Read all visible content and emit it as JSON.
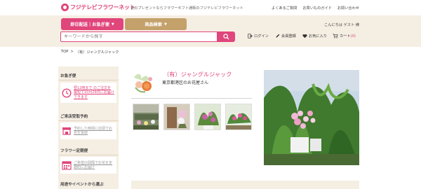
{
  "header": {
    "logo_text": "フジテレビフラワーネット",
    "tagline": "花のプレゼントならフラワーギフト通販のフジテレビフラワーネット",
    "links": [
      "よくあるご質問",
      "お買いものガイド",
      "お問い合わせ"
    ],
    "greeting": "こんにちは ゲスト 様"
  },
  "nav": {
    "tab_fast": "即日配送｜お急ぎ便",
    "tab_search": "商品検索",
    "search_placeholder": "キーワードから探す",
    "login": "ログイン",
    "register": "会員登録",
    "favorites": "お気に入り",
    "cart": "カート",
    "cart_count": "(0)"
  },
  "breadcrumb": {
    "home": "TOP",
    "sep": ">",
    "current": "（有）ジャングルジャック"
  },
  "sidebar": {
    "rush_head": "お急ぎ便",
    "rush_text": "昼12時まで のご注文を 最短で10月29日にお届けできます",
    "pickup_head": "ご来店受取予約",
    "pickup_text": "予約した時間に店頭でお花を受取",
    "subscription_head": "フラワー定期便",
    "subscription_text": "ご希望の間隔でお花を定期的にお届け",
    "occasion_head": "用途やイベントから選ぶ"
  },
  "shop": {
    "name": "（有）ジャングルジャック",
    "location": "東京都港区のお花屋さん"
  },
  "colors": {
    "brand": "#e0457b",
    "gold": "#c4a16b",
    "band": "#f5eee3"
  }
}
